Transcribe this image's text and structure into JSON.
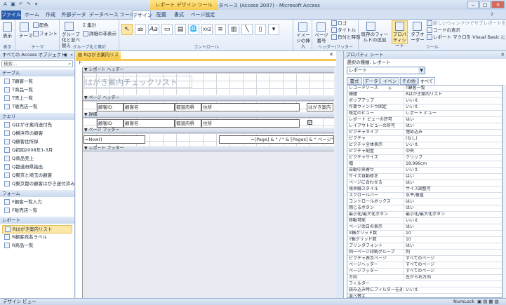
{
  "window": {
    "title": "5章完成：データベース (Access 2007) - Microsoft Access",
    "context_tab": "レポート デザイン ツール"
  },
  "ribbon_tabs": [
    "ファイル",
    "ホーム",
    "作成",
    "外部データ",
    "データベース ツール",
    "デザイン",
    "配置",
    "書式",
    "ページ設定"
  ],
  "ribbon": {
    "groups": {
      "view": "表示",
      "theme": "テーマ",
      "grouping": "グループ化と集計",
      "controls": "コントロール",
      "header_footer": "ヘッダー/フッター",
      "tools": "ツール"
    },
    "buttons": {
      "view": "表示",
      "theme": "テーマ",
      "colors": "配色",
      "fonts": "フォント",
      "group_sort": "グループ化と並べ替え",
      "totals": "集計",
      "hide_details": "詳細の非表示",
      "insert_image": "イメージの挿入",
      "page_numbers": "ページ番号",
      "logo": "ロゴ",
      "title": "タイトル",
      "date_time": "日付と時刻",
      "add_fields": "既存のフィールドの追加",
      "property_sheet": "プロパティシート",
      "tab_order": "タブオーダー",
      "subreport_new_window": "新しいウィンドウでサブレポートを開く",
      "view_code": "コードの表示",
      "convert_macros": "レポート マクロを Visual Basic に変換"
    }
  },
  "nav_pane": {
    "header": "すべての Access オブジェクト",
    "search_placeholder": "検索...",
    "sections": [
      {
        "label": "テーブル",
        "items": [
          "T顧客一覧",
          "T商品一覧",
          "T売上一覧",
          "T販売店一覧"
        ]
      },
      {
        "label": "クエリ",
        "items": [
          "Qはがき案内送付先",
          "Q横浜市の顧客",
          "Q顧客住所録",
          "Q初回2008年1-3月",
          "Q商品売上",
          "Q都道府県抽出",
          "Q東京と埼玉の顧客",
          "Q東京都の顧客はがき送付済み"
        ]
      },
      {
        "label": "フォーム",
        "items": [
          "F顧客一覧入力",
          "F販売店一覧"
        ]
      },
      {
        "label": "レポート",
        "items": [
          "Rはがき案内リスト",
          "R顧客宛名ラベル",
          "R商品一覧"
        ]
      }
    ],
    "selected_item": "Rはがき案内リスト"
  },
  "design": {
    "doc_tab": "Rはがき案内リスト",
    "sections": [
      "レポート ヘッダー",
      "ページ ヘッダー",
      "詳細",
      "ページ フッター",
      "レポート フッター"
    ],
    "report_title": "はがき案内チェックリスト",
    "page_header_labels": [
      "顧客ID",
      "顧客名",
      "都道府県",
      "住所",
      "はがき案内"
    ],
    "detail_fields": [
      "顧客ID",
      "顧客名",
      "都道府県",
      "住所"
    ],
    "detail_check": "☑",
    "footer_now": "=Now()",
    "footer_page": "=[Page] & \" / \" & [Pages] & \" ページ\""
  },
  "property_sheet": {
    "header": "プロパティ シート",
    "selection_kind": "選択の種類: レポート",
    "selected": "レポート",
    "tabs": [
      "書式",
      "データ",
      "イベント",
      "その他",
      "すべて"
    ],
    "active_tab": "すべて",
    "rows": [
      {
        "name": "レコードソース",
        "value": "T顧客一覧"
      },
      {
        "name": "標題",
        "value": "Rはがき案内リスト"
      },
      {
        "name": "ポップアップ",
        "value": "いいえ"
      },
      {
        "name": "作業ウィンドウ固定",
        "value": "いいえ"
      },
      {
        "name": "既定のビュー",
        "value": "レポート ビュー"
      },
      {
        "name": "レポート ビューの許可",
        "value": "はい"
      },
      {
        "name": "レイアウトビューの許可",
        "value": "はい"
      },
      {
        "name": "ピクチャタイプ",
        "value": "埋め込み"
      },
      {
        "name": "ピクチャ",
        "value": "(なし)"
      },
      {
        "name": "ピクチャ全体表示",
        "value": "いいえ"
      },
      {
        "name": "ピクチャ配置",
        "value": "中央"
      },
      {
        "name": "ピクチャサイズ",
        "value": "クリップ"
      },
      {
        "name": "幅",
        "value": "18.996cm"
      },
      {
        "name": "自動中央寄せ",
        "value": "いいえ"
      },
      {
        "name": "サイズ自動修正",
        "value": "はい"
      },
      {
        "name": "ページに合わせる",
        "value": "はい"
      },
      {
        "name": "境界線スタイル",
        "value": "サイズ調整可"
      },
      {
        "name": "スクロールバー",
        "value": "水平/垂直"
      },
      {
        "name": "コントロールボックス",
        "value": "はい"
      },
      {
        "name": "閉じるボタン",
        "value": "はい"
      },
      {
        "name": "最小化/最大化ボタン",
        "value": "最小化/最大化ボタン"
      },
      {
        "name": "移動可能",
        "value": "いいえ"
      },
      {
        "name": "ページ余白の表示",
        "value": "はい"
      },
      {
        "name": "X軸グリッド数",
        "value": "10"
      },
      {
        "name": "Y軸グリッド数",
        "value": "10"
      },
      {
        "name": "プリンタフォント",
        "value": "はい"
      },
      {
        "name": "同一ページ印刷グループ",
        "value": "列"
      },
      {
        "name": "ピクチャ表示ページ",
        "value": "すべてのページ"
      },
      {
        "name": "ページヘッダー",
        "value": "すべてのページ"
      },
      {
        "name": "ページフッター",
        "value": "すべてのページ"
      },
      {
        "name": "方向",
        "value": "左から右方向"
      },
      {
        "name": "フィルター",
        "value": ""
      },
      {
        "name": "読み込み時にフィルターを適用",
        "value": "いいえ"
      },
      {
        "name": "並べ替え",
        "value": ""
      },
      {
        "name": "読み込み時に並べ替えを適用",
        "value": "はい"
      }
    ]
  },
  "status_bar": {
    "left": "デザイン ビュー",
    "numlock": "NumLock"
  },
  "colors": {
    "file_tab": "#2a5cab",
    "context_tab": "#f7c94f",
    "selected_item": "#fbe7a8"
  }
}
